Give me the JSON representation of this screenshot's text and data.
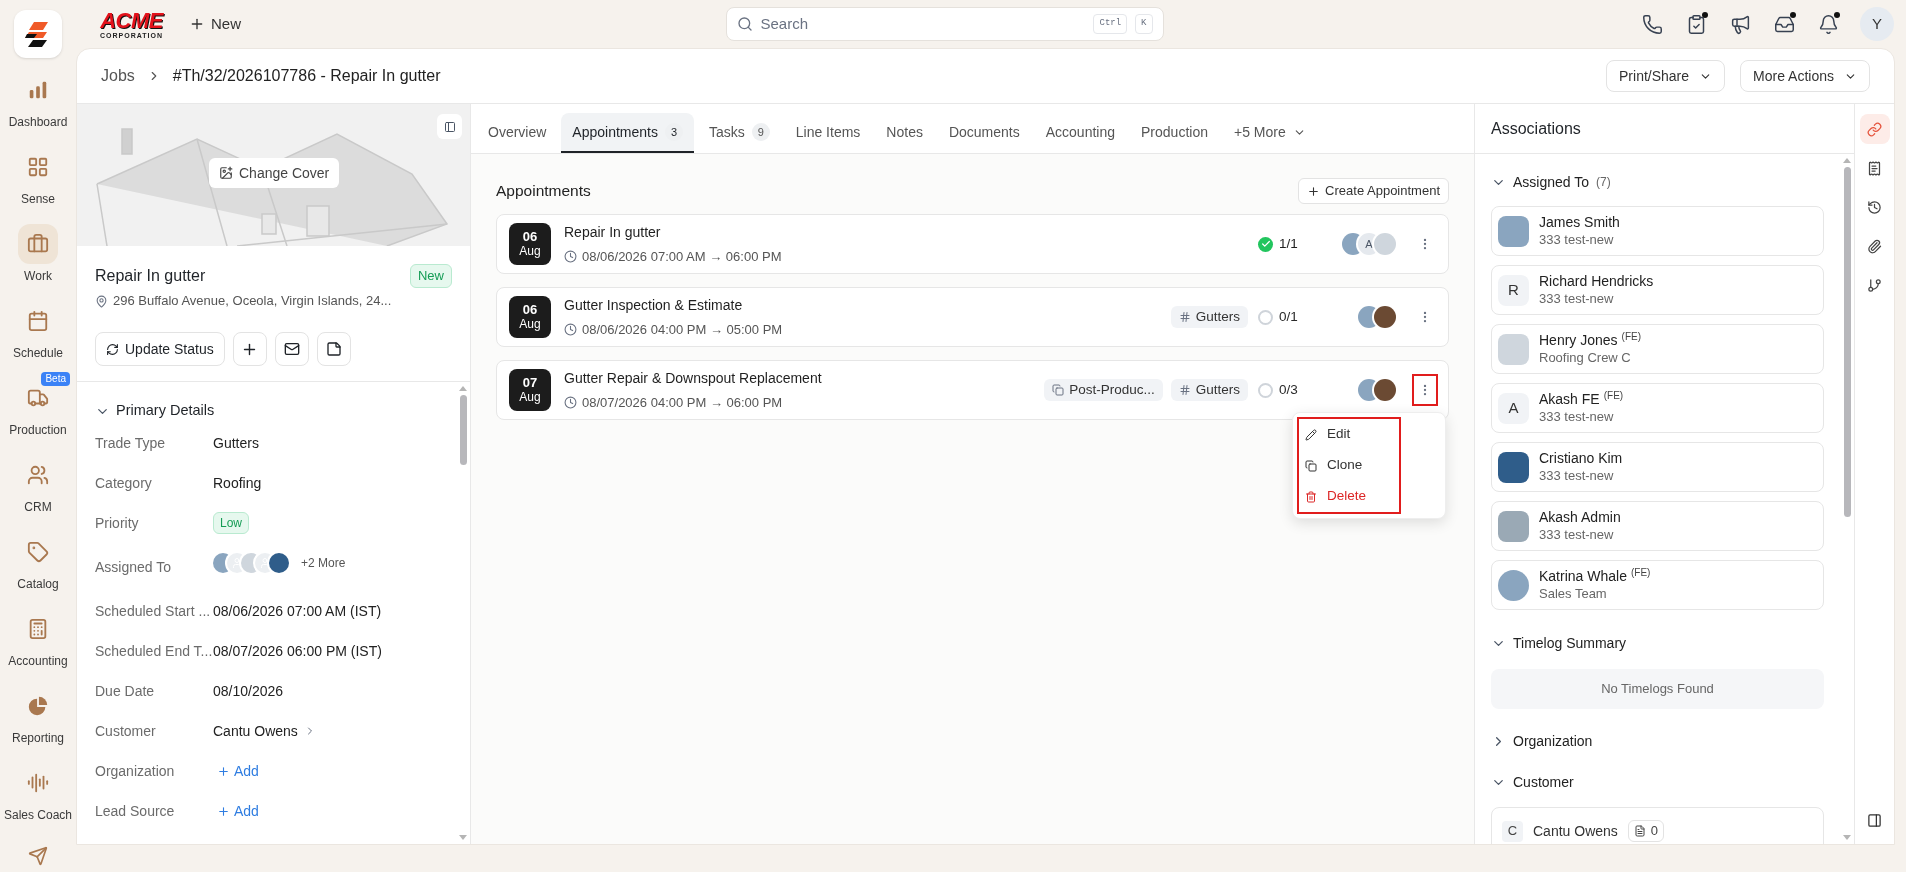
{
  "nav": {
    "items": [
      {
        "label": "Dashboard",
        "selected": false
      },
      {
        "label": "Sense",
        "selected": false
      },
      {
        "label": "Work",
        "selected": true
      },
      {
        "label": "Schedule",
        "selected": false
      },
      {
        "label": "Production",
        "selected": false,
        "badge": "Beta"
      },
      {
        "label": "CRM",
        "selected": false
      },
      {
        "label": "Catalog",
        "selected": false
      },
      {
        "label": "Accounting",
        "selected": false
      },
      {
        "label": "Reporting",
        "selected": false
      },
      {
        "label": "Sales Coach",
        "selected": false
      }
    ]
  },
  "topbar": {
    "brand": {
      "name": "ACME",
      "sub": "CORPORATION"
    },
    "new_button": "New",
    "search": {
      "placeholder": "Search",
      "keys": [
        "Ctrl",
        "K"
      ]
    },
    "icons": [
      {
        "dot": false
      },
      {
        "dot": true
      },
      {
        "dot": false
      },
      {
        "dot": true
      },
      {
        "dot": true
      }
    ],
    "avatar": "Y"
  },
  "header": {
    "breadcrumb": [
      "Jobs",
      "#Th/32/2026107786 - Repair In gutter"
    ],
    "actions": [
      "Print/Share",
      "More Actions"
    ]
  },
  "job": {
    "cover_button": "Change Cover",
    "title": "Repair In gutter",
    "status": "New",
    "address": "296 Buffalo Avenue, Oceola, Virgin Islands, 24...",
    "update_button": "Update Status"
  },
  "primary_details": {
    "title": "Primary Details",
    "expanded": true,
    "fields": [
      {
        "label": "Trade Type",
        "kind": "text",
        "value": "Gutters"
      },
      {
        "label": "Category",
        "kind": "text",
        "value": "Roofing"
      },
      {
        "label": "Priority",
        "kind": "badge",
        "value": "Low"
      },
      {
        "label": "Assigned To",
        "kind": "avatars",
        "avatars": [
          {
            "kind": "photo"
          },
          {
            "kind": "silhouette"
          },
          {
            "kind": "photo"
          },
          {
            "kind": "silhouette"
          },
          {
            "kind": "photo"
          }
        ],
        "value": "+2 More"
      },
      {
        "label": "Scheduled Start ...",
        "kind": "text",
        "value": "08/06/2026 07:00 AM (IST)"
      },
      {
        "label": "Scheduled End T...",
        "kind": "text",
        "value": "08/07/2026 06:00 PM (IST)"
      },
      {
        "label": "Due Date",
        "kind": "text",
        "value": "08/10/2026"
      },
      {
        "label": "Customer",
        "kind": "link",
        "value": "Cantu Owens"
      },
      {
        "label": "Organization",
        "kind": "add",
        "value": "Add"
      },
      {
        "label": "Lead Source",
        "kind": "add",
        "value": "Add"
      }
    ]
  },
  "tabs": [
    {
      "label": "Overview",
      "selected": false
    },
    {
      "label": "Appointments",
      "count": "3",
      "selected": true
    },
    {
      "label": "Tasks",
      "count": "9",
      "selected": false
    },
    {
      "label": "Line Items",
      "selected": false
    },
    {
      "label": "Notes",
      "selected": false
    },
    {
      "label": "Documents",
      "selected": false
    },
    {
      "label": "Accounting",
      "selected": false
    },
    {
      "label": "Production",
      "selected": false
    },
    {
      "label": "+5 More",
      "kind": "more",
      "selected": false
    }
  ],
  "appointments": {
    "heading": "Appointments",
    "create_button": "Create Appointment",
    "items": [
      {
        "day": "06",
        "month": "Aug",
        "title": "Repair In gutter",
        "time": "08/06/2026 07:00 AM → 06:00 PM",
        "done": true,
        "progress": "1/1",
        "avatars": [
          {
            "kind": "photo"
          },
          {
            "kind": "letter",
            "letter": "A"
          },
          {
            "kind": "photo"
          }
        ],
        "menu_open": false,
        "highlighted": false
      },
      {
        "day": "06",
        "month": "Aug",
        "title": "Gutter Inspection & Estimate",
        "time": "08/06/2026 04:00 PM → 05:00 PM",
        "tags": [
          {
            "kind": "tag",
            "label": "Gutters"
          }
        ],
        "done": false,
        "progress": "0/1",
        "avatars": [
          {
            "kind": "photo"
          },
          {
            "kind": "photo"
          }
        ],
        "menu_open": false,
        "highlighted": false
      },
      {
        "day": "07",
        "month": "Aug",
        "title": "Gutter Repair & Downspout Replacement",
        "time": "08/07/2026 04:00 PM → 06:00 PM",
        "tags": [
          {
            "kind": "stage",
            "label": "Post-Produc..."
          },
          {
            "kind": "tag",
            "label": "Gutters"
          }
        ],
        "done": false,
        "progress": "0/3",
        "avatars": [
          {
            "kind": "photo"
          },
          {
            "kind": "photo"
          }
        ],
        "menu_open": true,
        "highlighted": true
      }
    ],
    "menu": {
      "highlighted": true,
      "items": [
        {
          "label": "Edit",
          "kind": "edit"
        },
        {
          "label": "Clone",
          "kind": "clone"
        },
        {
          "label": "Delete",
          "kind": "delete"
        }
      ]
    }
  },
  "associations": {
    "title": "Associations",
    "assigned": {
      "title": "Assigned To",
      "count": "(7)",
      "expanded": true,
      "people": [
        {
          "name": "James Smith",
          "sub": "333 test-new",
          "avatar": {
            "kind": "photo"
          }
        },
        {
          "name": "Richard Hendricks",
          "sub": "333 test-new",
          "avatar": {
            "kind": "letter",
            "letter": "R"
          }
        },
        {
          "name": "Henry Jones",
          "role": "(FE)",
          "sub": "Roofing Crew C",
          "avatar": {
            "kind": "photo"
          }
        },
        {
          "name": "Akash FE",
          "role": "(FE)",
          "sub": "333 test-new",
          "avatar": {
            "kind": "letter",
            "letter": "A"
          }
        },
        {
          "name": "Cristiano Kim",
          "sub": "333 test-new",
          "avatar": {
            "kind": "photo"
          }
        },
        {
          "name": "Akash Admin",
          "sub": "333 test-new",
          "avatar": {
            "kind": "photo"
          }
        },
        {
          "name": "Katrina Whale",
          "role": "(FE)",
          "sub": "Sales Team",
          "avatar": {
            "kind": "photo"
          }
        }
      ]
    },
    "timelog": {
      "title": "Timelog Summary",
      "expanded": true,
      "empty": "No Timelogs Found"
    },
    "organization": {
      "title": "Organization",
      "expanded": false
    },
    "customer": {
      "title": "Customer",
      "expanded": true,
      "letter": "C",
      "name": "Cantu Owens",
      "notes": "0"
    }
  },
  "rail": {
    "items": [
      {
        "selected": true
      },
      {
        "selected": false
      },
      {
        "selected": false
      },
      {
        "selected": false
      },
      {
        "selected": false
      }
    ]
  }
}
